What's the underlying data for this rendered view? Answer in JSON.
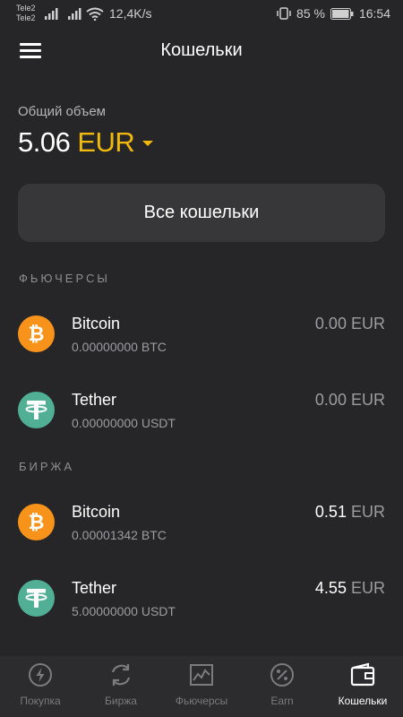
{
  "status_bar": {
    "carrier1": "Tele2",
    "carrier2": "Tele2",
    "net_speed": "12,4K/s",
    "battery": "85 %",
    "time": "16:54"
  },
  "header": {
    "title": "Кошельки"
  },
  "total": {
    "label": "Общий объем",
    "value": "5.06",
    "currency": "EUR"
  },
  "all_wallets_button": "Все кошельки",
  "sections": [
    {
      "title": "ФЬЮЧЕРСЫ",
      "assets": [
        {
          "name": "Bitcoin",
          "amount": "0.00000000 BTC",
          "value_num": "0.00",
          "value_cur": "EUR",
          "icon": "bitcoin-icon"
        },
        {
          "name": "Tether",
          "amount": "0.00000000 USDT",
          "value_num": "0.00",
          "value_cur": "EUR",
          "icon": "tether-icon"
        }
      ]
    },
    {
      "title": "БИРЖА",
      "assets": [
        {
          "name": "Bitcoin",
          "amount": "0.00001342 BTC",
          "value_num": "0.51",
          "value_cur": "EUR",
          "icon": "bitcoin-icon"
        },
        {
          "name": "Tether",
          "amount": "5.00000000 USDT",
          "value_num": "4.55",
          "value_cur": "EUR",
          "icon": "tether-icon"
        }
      ]
    }
  ],
  "bottom_nav": [
    {
      "label": "Покупка",
      "icon": "lightning-icon",
      "active": false
    },
    {
      "label": "Биржа",
      "icon": "exchange-icon",
      "active": false
    },
    {
      "label": "Фьючерсы",
      "icon": "chart-icon",
      "active": false
    },
    {
      "label": "Earn",
      "icon": "percent-icon",
      "active": false
    },
    {
      "label": "Кошельки",
      "icon": "wallet-icon",
      "active": true
    }
  ],
  "colors": {
    "background": "#262628",
    "accent": "#f0b90b",
    "button_bg": "#37373a",
    "bitcoin": "#f7931a",
    "tether": "#50af95"
  }
}
